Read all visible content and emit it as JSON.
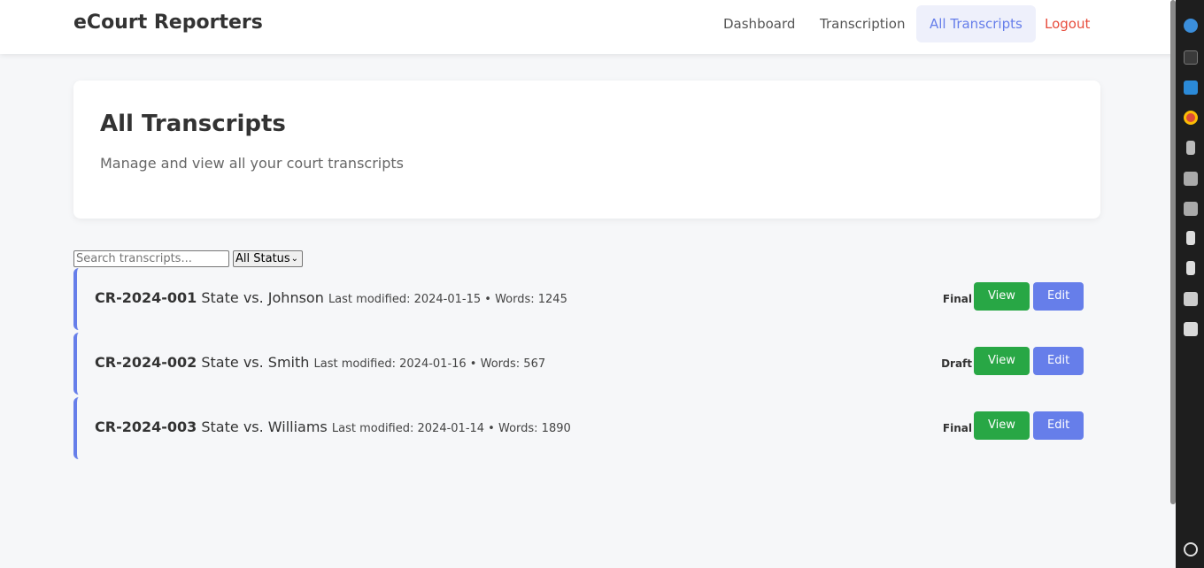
{
  "app": {
    "brand": "eCourt Reporters"
  },
  "nav": {
    "dashboard": "Dashboard",
    "transcription": "Transcription",
    "all_transcripts": "All Transcripts",
    "logout": "Logout"
  },
  "header": {
    "title": "All Transcripts",
    "subtitle": "Manage and view all your court transcripts"
  },
  "filters": {
    "search_placeholder": "Search transcripts...",
    "status_selected": "All Status"
  },
  "transcripts": [
    {
      "id": "CR-2024-001",
      "case": "State vs. Johnson",
      "meta": "Last modified: 2024-01-15 • Words: 1245",
      "status": "Final",
      "view": "View",
      "edit": "Edit"
    },
    {
      "id": "CR-2024-002",
      "case": "State vs. Smith",
      "meta": "Last modified: 2024-01-16 • Words: 567",
      "status": "Draft",
      "view": "View",
      "edit": "Edit"
    },
    {
      "id": "CR-2024-003",
      "case": "State vs. Williams",
      "meta": "Last modified: 2024-01-14 • Words: 1890",
      "status": "Final",
      "view": "View",
      "edit": "Edit"
    }
  ],
  "colors": {
    "accent": "#667eea",
    "view_button": "#28a745",
    "logout": "#e74c3c"
  },
  "dock_icons": [
    "help-icon",
    "terminal-icon",
    "vscode-icon",
    "chrome-icon",
    "drive-icon",
    "disk-icon",
    "disk-icon",
    "device-icon",
    "device-icon",
    "camera-icon",
    "trash-icon",
    "settings-icon"
  ]
}
